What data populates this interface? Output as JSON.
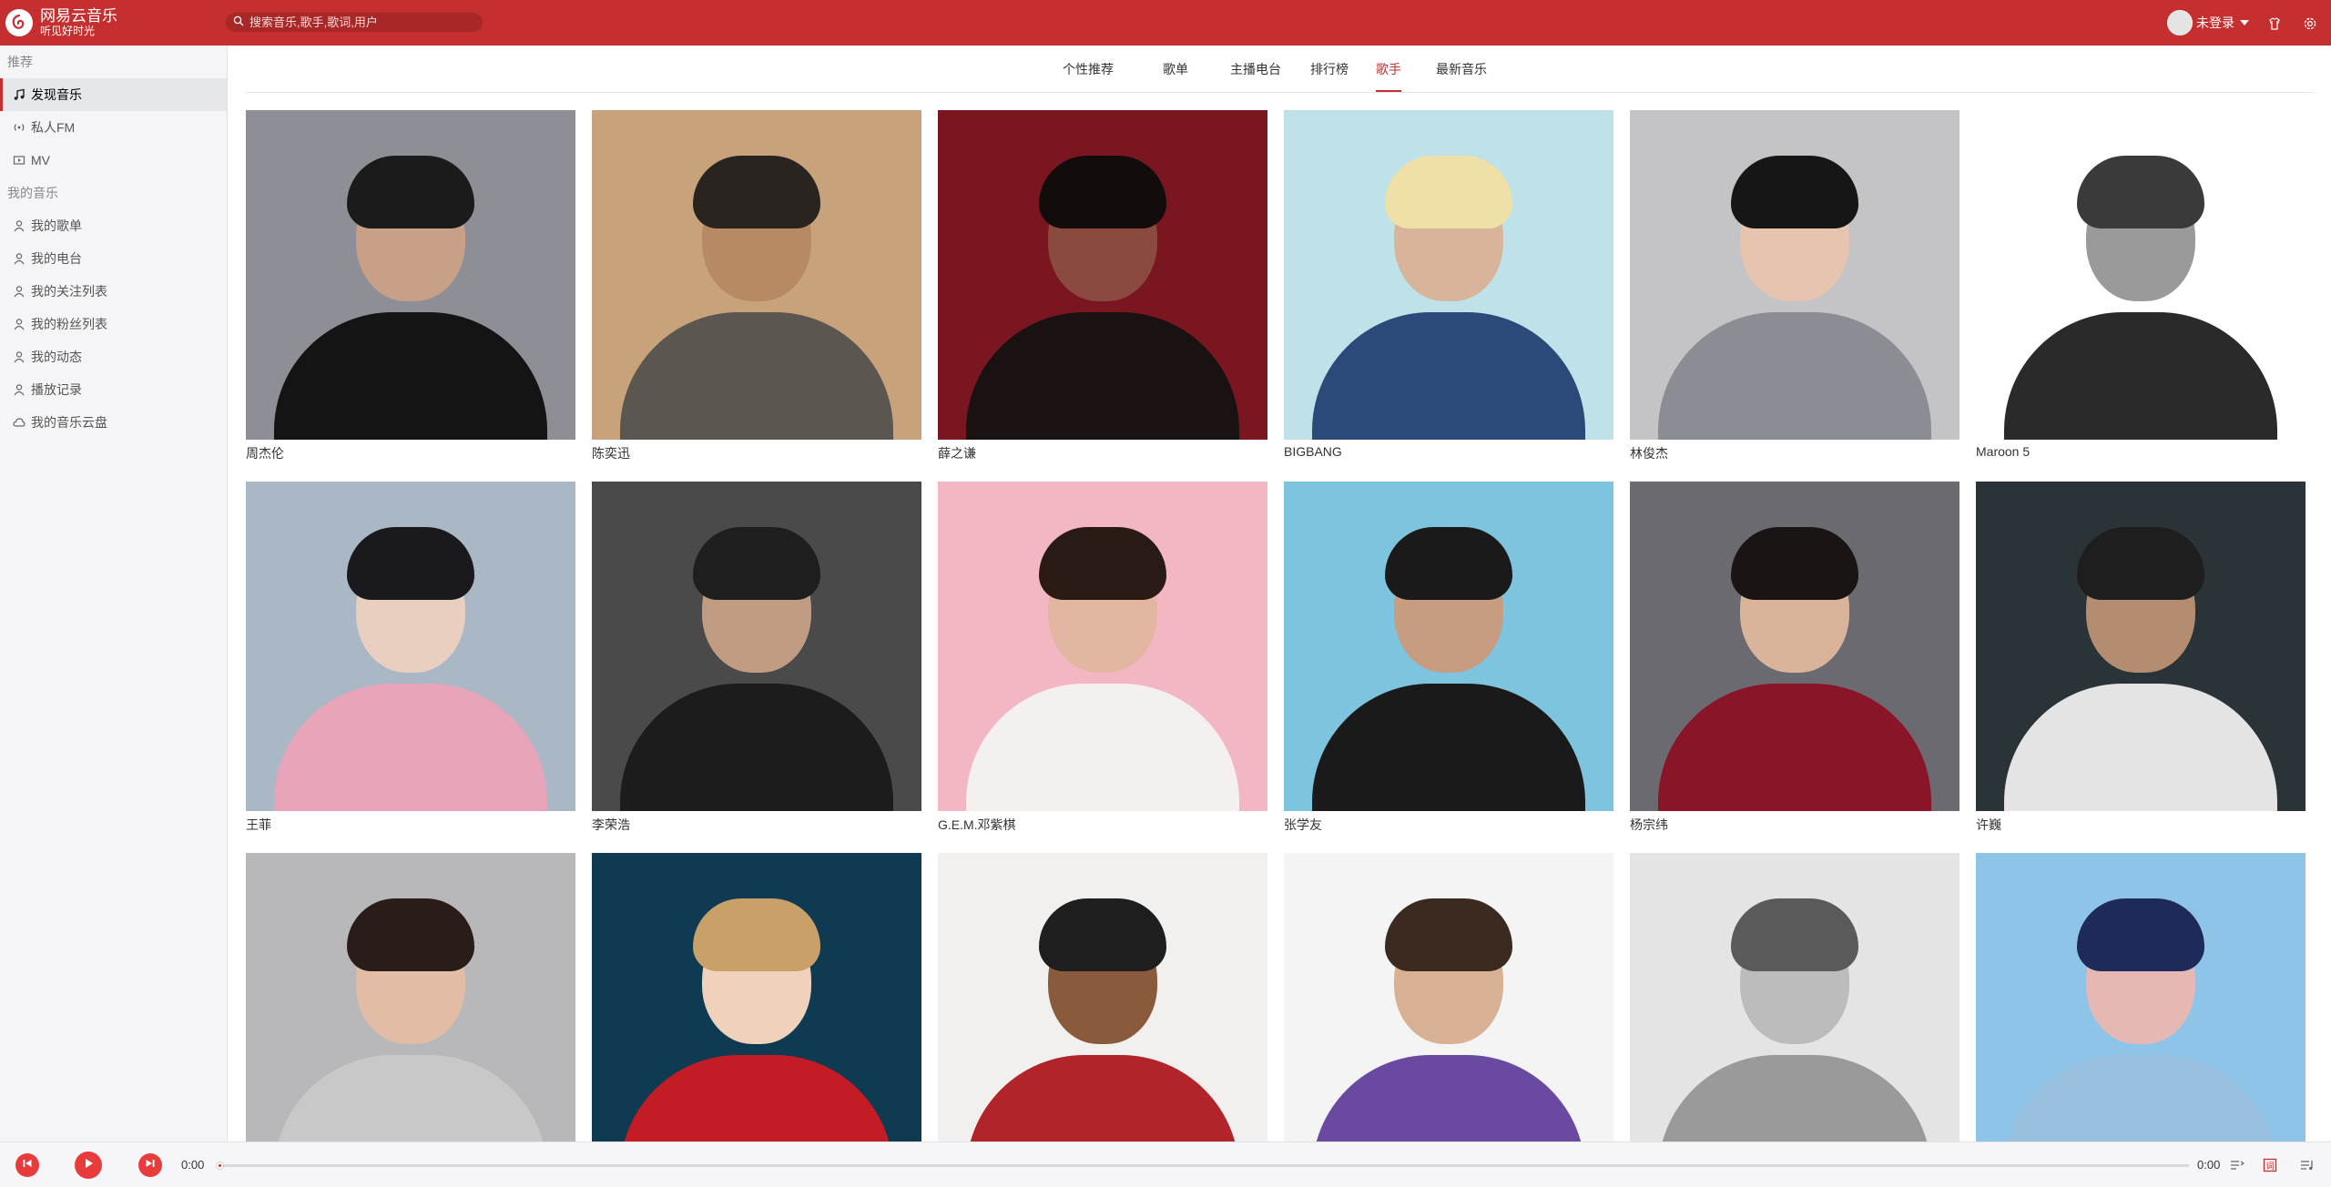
{
  "app": {
    "name": "网易云音乐",
    "slogan": "听见好时光"
  },
  "search": {
    "placeholder": "搜索音乐,歌手,歌词,用户"
  },
  "user": {
    "status": "未登录"
  },
  "sidebar": {
    "section_recommend": "推荐",
    "recommend_items": [
      {
        "label": "发现音乐",
        "icon": "music-note-icon"
      },
      {
        "label": "私人FM",
        "icon": "radio-icon"
      },
      {
        "label": "MV",
        "icon": "video-icon"
      }
    ],
    "section_my_music": "我的音乐",
    "my_items": [
      {
        "label": "我的歌单",
        "icon": "user-icon"
      },
      {
        "label": "我的电台",
        "icon": "user-icon"
      },
      {
        "label": "我的关注列表",
        "icon": "user-icon"
      },
      {
        "label": "我的粉丝列表",
        "icon": "user-icon"
      },
      {
        "label": "我的动态",
        "icon": "user-icon"
      },
      {
        "label": "播放记录",
        "icon": "user-icon"
      },
      {
        "label": "我的音乐云盘",
        "icon": "cloud-icon"
      }
    ]
  },
  "tabs": [
    {
      "label": "个性推荐"
    },
    {
      "label": "歌单"
    },
    {
      "label": "主播电台"
    },
    {
      "label": "排行榜"
    },
    {
      "label": "歌手"
    },
    {
      "label": "最新音乐"
    }
  ],
  "active_tab": "歌手",
  "artists": [
    {
      "name": "周杰伦",
      "bg": "#8e8e96",
      "skin": "#c8a088",
      "hair": "#1b1b1b",
      "cloth": "#141414"
    },
    {
      "name": "陈奕迅",
      "bg": "#c8a27a",
      "skin": "#b88a64",
      "hair": "#2a2420",
      "cloth": "#5b5650"
    },
    {
      "name": "薛之谦",
      "bg": "#7a1620",
      "skin": "#8a4a40",
      "hair": "#120c0c",
      "cloth": "#1a1212"
    },
    {
      "name": "BIGBANG",
      "bg": "#bfe2e8",
      "skin": "#d7b49a",
      "hair": "#efe0a8",
      "cloth": "#2b4a7a"
    },
    {
      "name": "林俊杰",
      "bg": "#c4c4c6",
      "skin": "#e6c4ae",
      "hair": "#161616",
      "cloth": "#8a8d94"
    },
    {
      "name": "Maroon 5",
      "bg": "#ffffff",
      "skin": "#9a9a9a",
      "hair": "#3a3a3a",
      "cloth": "#2a2a2a"
    },
    {
      "name": "王菲",
      "bg": "#a9b8c4",
      "skin": "#e8cfc0",
      "hair": "#1a1a1e",
      "cloth": "#e8a4b8"
    },
    {
      "name": "李荣浩",
      "bg": "#4a4a4a",
      "skin": "#c09c82",
      "hair": "#1e1e1e",
      "cloth": "#1c1c1c"
    },
    {
      "name": "G.E.M.邓紫棋",
      "bg": "#f3b7c4",
      "skin": "#e2b6a0",
      "hair": "#2a1a14",
      "cloth": "#f4f0f0"
    },
    {
      "name": "张学友",
      "bg": "#7ec4de",
      "skin": "#c89c80",
      "hair": "#1a1a1a",
      "cloth": "#1a1a1a"
    },
    {
      "name": "杨宗纬",
      "bg": "#6a6a70",
      "skin": "#d9b49a",
      "hair": "#1a1414",
      "cloth": "#8a1428"
    },
    {
      "name": "许巍",
      "bg": "#2a3438",
      "skin": "#b48c70",
      "hair": "#1e1e1e",
      "cloth": "#e4e4e4"
    },
    {
      "name": "",
      "bg": "#b8b8ba",
      "skin": "#e2bca4",
      "hair": "#2a1c18",
      "cloth": "#c8c8c8"
    },
    {
      "name": "",
      "bg": "#0e3a52",
      "skin": "#f0d2bc",
      "hair": "#c8a068",
      "cloth": "#c41c24"
    },
    {
      "name": "",
      "bg": "#f2f0ee",
      "skin": "#8a5a3c",
      "hair": "#1e1e1e",
      "cloth": "#b0242a"
    },
    {
      "name": "",
      "bg": "#f4f4f4",
      "skin": "#d8b094",
      "hair": "#3a2a20",
      "cloth": "#6a4aa0"
    },
    {
      "name": "",
      "bg": "#e4e4e4",
      "skin": "#bcbcbc",
      "hair": "#5a5a5a",
      "cloth": "#9a9a9a"
    },
    {
      "name": "",
      "bg": "#8ec4e8",
      "skin": "#e6b8b4",
      "hair": "#1e2a5a",
      "cloth": "#9ac0e0"
    }
  ],
  "player": {
    "current_time": "0:00",
    "total_time": "0:00",
    "progress": 0
  },
  "colors": {
    "brand": "#c62f2f",
    "play_button": "#e83c3c",
    "sidebar_bg": "#f5f5f7"
  }
}
